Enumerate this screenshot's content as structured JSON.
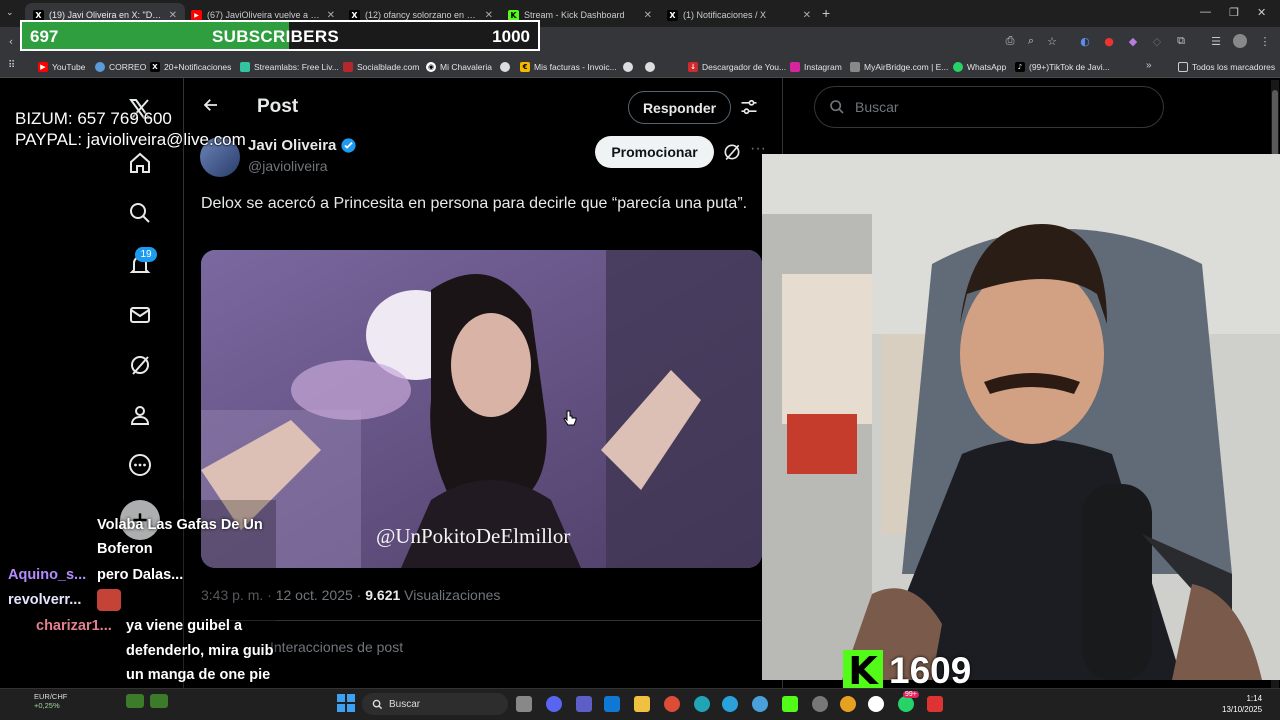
{
  "browser": {
    "tabs": [
      {
        "title": "(19) Javi Oliveira en X: \"Delo",
        "icon": "x-logo-icon"
      },
      {
        "title": "(67) JaviOliveira vuelve a atacar",
        "icon": "youtube-icon"
      },
      {
        "title": "(12) ofancy solorzano en X: \"Gr",
        "icon": "x-logo-icon"
      },
      {
        "title": "Stream - Kick Dashboard",
        "icon": "kick-icon"
      },
      {
        "title": "(1) Notificaciones / X",
        "icon": "x-logo-icon"
      }
    ],
    "bookmarks": [
      "YouTube",
      "CORREO",
      "20+Notificaciones",
      "Streamlabs: Free Liv...",
      "Socialblade.com",
      "Mi Chavaleria",
      "Mis facturas - Invoic...",
      "Descargador de You...",
      "Instagram",
      "MyAirBridge.com | E...",
      "WhatsApp",
      "(99+)TikTok de Javi..."
    ],
    "all_bookmarks": "Todos los marcadores"
  },
  "subscribers": {
    "count": "697",
    "label": "SUBSCRIBERS",
    "goal": "1000",
    "progress": 0.697
  },
  "donation": {
    "bizum": "BIZUM: 657 769 600",
    "paypal": "PAYPAL: javioliveira@live.com"
  },
  "x": {
    "notifications_badge": "19",
    "header_title": "Post",
    "reply_button": "Responder",
    "search_placeholder": "Buscar",
    "author_name": "Javi Oliveira",
    "author_handle": "@javioliveira",
    "promote_button": "Promocionar",
    "post_text": "Delox se acercó a Princesita en persona para decirle que “parecía una puta”.",
    "watermark": "@UnPokitoDeElmillor",
    "time": "3:43 p. m.",
    "date": "12 oct. 2025",
    "views_count": "9.621",
    "views_label": "Visualizaciones",
    "interactions": "Interacciones de post"
  },
  "chat": {
    "line1": "Volaba Las Gafas De Un",
    "line2": "Boferon",
    "line3": "pero Dalas...",
    "user1": "Aquino_s...",
    "user2": "revolverr...",
    "user3": "charizar1...",
    "line4": "ya viene guibel a",
    "line5": "defenderlo, mira guib",
    "line6": "un manga de one pie"
  },
  "kick": {
    "viewers": "1609"
  },
  "taskbar": {
    "search": "Buscar",
    "time": "1:14",
    "date": "13/10/2025",
    "ticker": "EUR/CHF",
    "ticker_change": "+0,25%",
    "badge": "99+"
  },
  "colors": {
    "x_blue": "#1d9bf0",
    "kick_green": "#53fc18",
    "subs_green": "#2e9e3e"
  }
}
